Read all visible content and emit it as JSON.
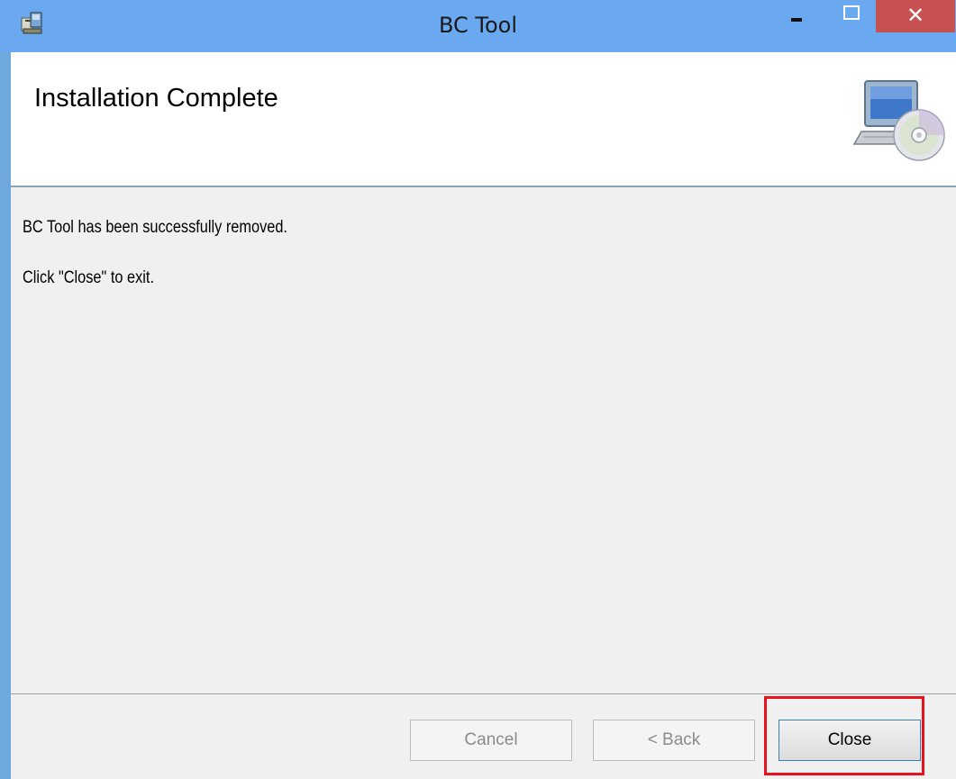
{
  "window": {
    "title": "BC Tool",
    "minimize_icon": "minimize-icon",
    "maximize_icon": "maximize-icon",
    "close_glyph": "✕",
    "titlebar_color": "#6aa9ef",
    "close_color": "#c75050"
  },
  "header": {
    "title": "Installation Complete",
    "graphic_icon": "computer-cd-icon"
  },
  "body": {
    "message": "BC Tool has been successfully removed.",
    "instruction": "Click \"Close\" to exit."
  },
  "footer": {
    "cancel_label": "Cancel",
    "back_label": "< Back",
    "close_label": "Close",
    "highlight_color": "#e8121c"
  }
}
